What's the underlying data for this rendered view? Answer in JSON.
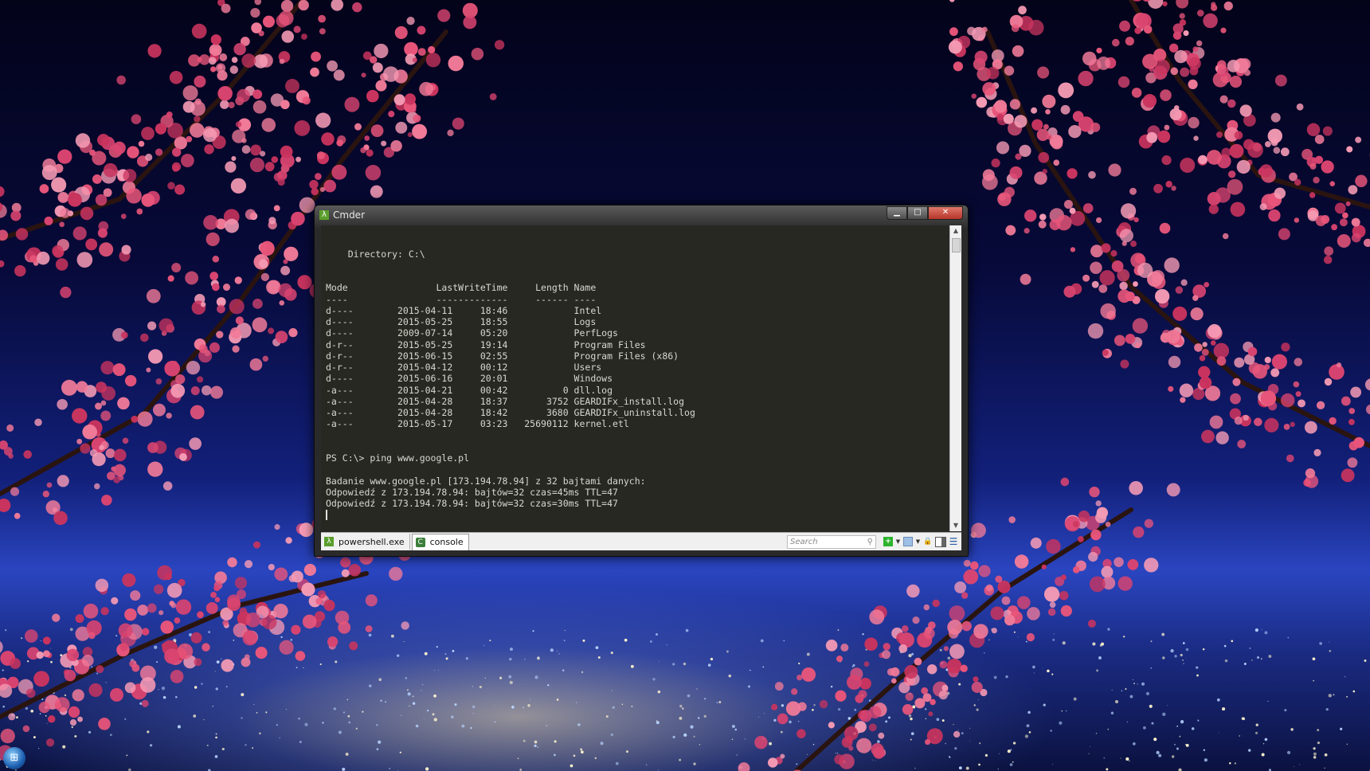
{
  "window": {
    "title": "Cmder",
    "app_icon": "λ",
    "buttons": {
      "minimize": "▁",
      "maximize": "□",
      "close": "✕"
    }
  },
  "terminal": {
    "lines": [
      "",
      "",
      "    Directory: C:\\",
      "",
      "",
      "Mode                LastWriteTime     Length Name",
      "----                -------------     ------ ----",
      "d----        2015-04-11     18:46            Intel",
      "d----        2015-05-25     18:55            Logs",
      "d----        2009-07-14     05:20            PerfLogs",
      "d-r--        2015-05-25     19:14            Program Files",
      "d-r--        2015-06-15     02:55            Program Files (x86)",
      "d-r--        2015-04-12     00:12            Users",
      "d----        2015-06-16     20:01            Windows",
      "-a---        2015-04-21     00:42          0 dll.log",
      "-a---        2015-04-28     18:37       3752 GEARDIFx_install.log",
      "-a---        2015-04-28     18:42       3680 GEARDIFx_uninstall.log",
      "-a---        2015-05-17     03:23   25690112 kernel.etl",
      "",
      "",
      "PS C:\\> ping www.google.pl",
      "",
      "Badanie www.google.pl [173.194.78.94] z 32 bajtami danych:",
      "Odpowiedź z 173.194.78.94: bajtów=32 czas=45ms TTL=47",
      "Odpowiedź z 173.194.78.94: bajtów=32 czas=30ms TTL=47"
    ]
  },
  "statusbar": {
    "tabs": [
      {
        "label": "powershell.exe",
        "icon": "λ"
      },
      {
        "label": "console",
        "icon": "C"
      }
    ],
    "search_placeholder": "Search",
    "search_icon_glyph": "⚲"
  },
  "icons": {
    "new_console": "+",
    "dropdown": "▼",
    "lock": "🔒",
    "menu": "☰"
  },
  "colors": {
    "console_bg": "#272822",
    "console_fg": "#d8d8d0",
    "accent": "#5a9e2b"
  }
}
